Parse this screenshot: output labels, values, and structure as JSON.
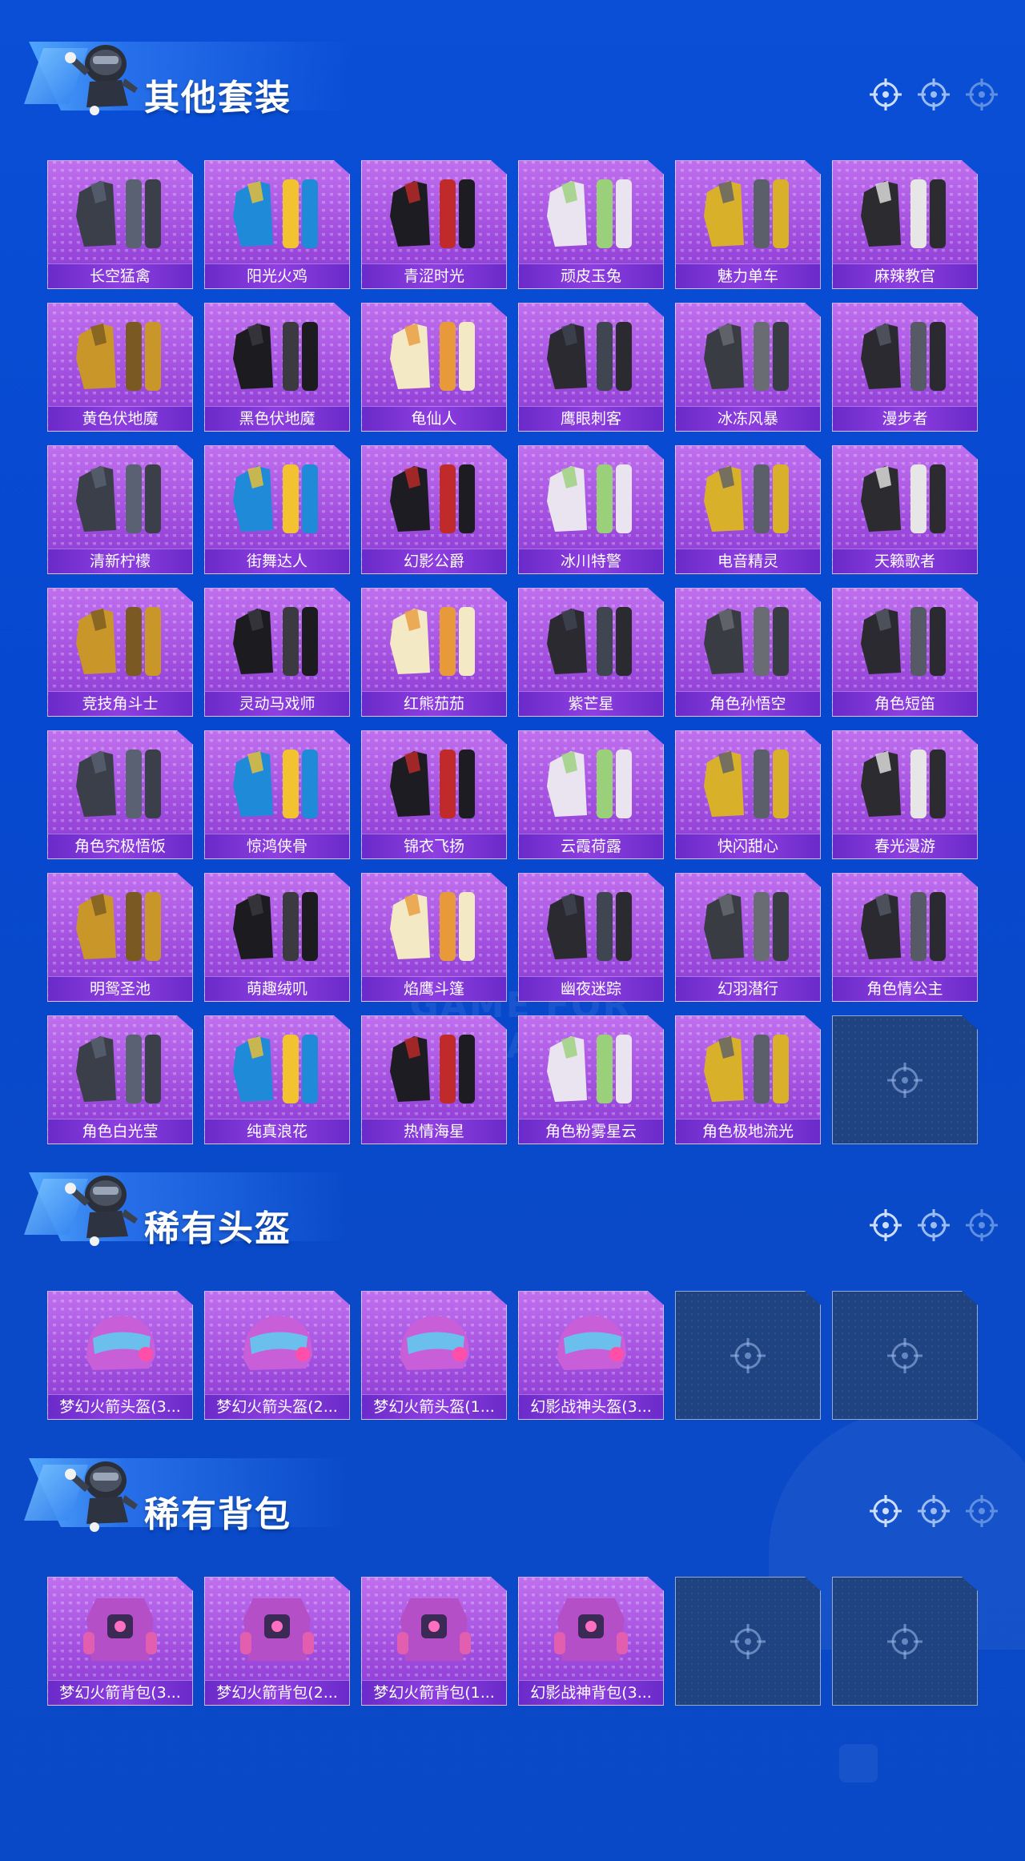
{
  "sections": [
    {
      "title": "其他套装",
      "items": [
        {
          "name": "长空猛禽",
          "empty": false
        },
        {
          "name": "阳光火鸡",
          "empty": false
        },
        {
          "name": "青涩时光",
          "empty": false
        },
        {
          "name": "顽皮玉兔",
          "empty": false
        },
        {
          "name": "魅力单车",
          "empty": false
        },
        {
          "name": "麻辣教官",
          "empty": false
        },
        {
          "name": "黄色伏地魔",
          "empty": false
        },
        {
          "name": "黑色伏地魔",
          "empty": false
        },
        {
          "name": "龟仙人",
          "empty": false
        },
        {
          "name": "鹰眼刺客",
          "empty": false
        },
        {
          "name": "冰冻风暴",
          "empty": false
        },
        {
          "name": "漫步者",
          "empty": false
        },
        {
          "name": "清新柠檬",
          "empty": false
        },
        {
          "name": "街舞达人",
          "empty": false
        },
        {
          "name": "幻影公爵",
          "empty": false
        },
        {
          "name": "冰川特警",
          "empty": false
        },
        {
          "name": "电音精灵",
          "empty": false
        },
        {
          "name": "天籁歌者",
          "empty": false
        },
        {
          "name": "竞技角斗士",
          "empty": false
        },
        {
          "name": "灵动马戏师",
          "empty": false
        },
        {
          "name": "红熊茄茄",
          "empty": false
        },
        {
          "name": "紫芒星",
          "empty": false
        },
        {
          "name": "角色孙悟空",
          "empty": false
        },
        {
          "name": "角色短笛",
          "empty": false
        },
        {
          "name": "角色究极悟饭",
          "empty": false
        },
        {
          "name": "惊鸿侠骨",
          "empty": false
        },
        {
          "name": "锦衣飞扬",
          "empty": false
        },
        {
          "name": "云霞荷露",
          "empty": false
        },
        {
          "name": "快闪甜心",
          "empty": false
        },
        {
          "name": "春光漫游",
          "empty": false
        },
        {
          "name": "明鸳圣池",
          "empty": false
        },
        {
          "name": "萌趣绒叽",
          "empty": false
        },
        {
          "name": "焰鹰斗篷",
          "empty": false
        },
        {
          "name": "幽夜迷踪",
          "empty": false
        },
        {
          "name": "幻羽潜行",
          "empty": false
        },
        {
          "name": "角色情公主",
          "empty": false
        },
        {
          "name": "角色白光莹",
          "empty": false
        },
        {
          "name": "纯真浪花",
          "empty": false
        },
        {
          "name": "热情海星",
          "empty": false
        },
        {
          "name": "角色粉雾星云",
          "empty": false
        },
        {
          "name": "角色极地流光",
          "empty": false
        },
        {
          "name": "",
          "empty": true
        }
      ]
    },
    {
      "title": "稀有头盔",
      "items": [
        {
          "name": "梦幻火箭头盔(3...",
          "empty": false
        },
        {
          "name": "梦幻火箭头盔(2...",
          "empty": false
        },
        {
          "name": "梦幻火箭头盔(1...",
          "empty": false
        },
        {
          "name": "幻影战神头盔(3...",
          "empty": false
        },
        {
          "name": "",
          "empty": true
        },
        {
          "name": "",
          "empty": true
        }
      ]
    },
    {
      "title": "稀有背包",
      "items": [
        {
          "name": "梦幻火箭背包(3...",
          "empty": false
        },
        {
          "name": "梦幻火箭背包(2...",
          "empty": false
        },
        {
          "name": "梦幻火箭背包(1...",
          "empty": false
        },
        {
          "name": "幻影战神背包(3...",
          "empty": false
        },
        {
          "name": "",
          "empty": true
        },
        {
          "name": "",
          "empty": true
        }
      ]
    }
  ],
  "watermark": "GAME FOR PEACE",
  "colors": {
    "background": "#0a4fd6",
    "card": "#a24fdf",
    "label_bar": "#7a34d6",
    "empty_slot": "#1f4380"
  }
}
